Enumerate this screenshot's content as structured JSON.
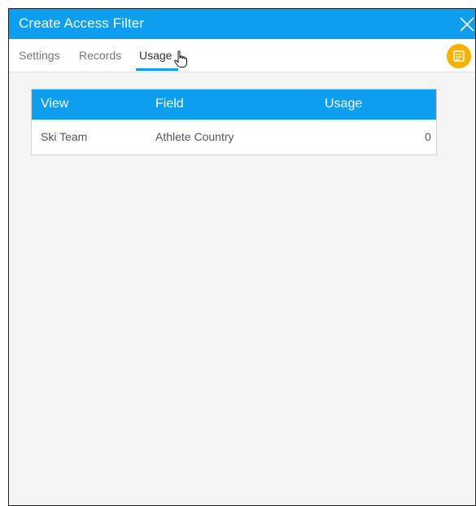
{
  "dialog": {
    "title": "Create Access Filter"
  },
  "tabs": [
    {
      "label": "Settings",
      "active": false
    },
    {
      "label": "Records",
      "active": false
    },
    {
      "label": "Usage",
      "active": true
    }
  ],
  "usage_table": {
    "columns": [
      "View",
      "Field",
      "Usage"
    ],
    "rows": [
      {
        "view": "Ski Team",
        "field": "Athlete Country",
        "usage": "0"
      }
    ]
  },
  "colors": {
    "accent": "#0d9ef0",
    "menu_button": "#f6b200",
    "background": "#f5f5f5"
  },
  "icons": {
    "close": "close-icon",
    "menu": "menu-icon",
    "cursor": "hand-pointer-cursor-icon"
  }
}
